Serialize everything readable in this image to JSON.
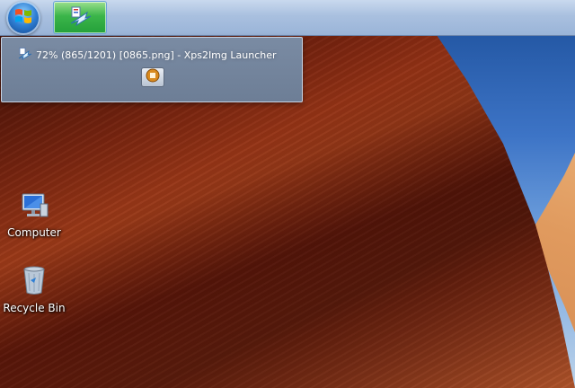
{
  "taskbar": {
    "start_icon": "windows-logo-icon",
    "active_app_icon": "xps2img-launcher-icon",
    "colors": {
      "taskbar": "#a9c0df",
      "active_button": "#3bb54a"
    }
  },
  "preview": {
    "title": "72% (865/1201) [0865.png] - Xps2Img Launcher",
    "progress": {
      "percent": 72,
      "current": 865,
      "total": 1201,
      "file": "0865.png"
    },
    "app_icon": "xps2img-launcher-icon",
    "stop_icon": "stop-icon"
  },
  "desktop": {
    "icons": [
      {
        "label": "Computer",
        "icon": "computer-icon"
      },
      {
        "label": "Recycle Bin",
        "icon": "recycle-bin-icon"
      }
    ]
  }
}
